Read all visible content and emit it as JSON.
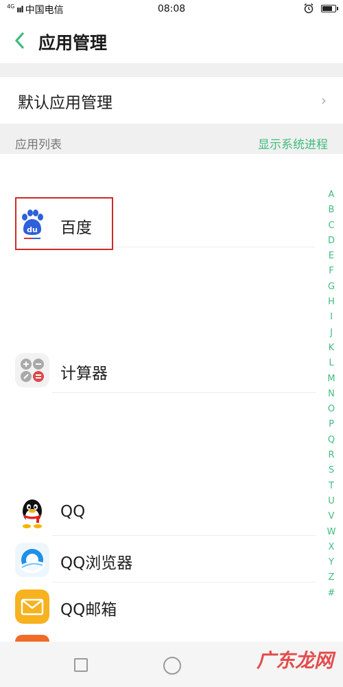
{
  "status_bar": {
    "network": "4G",
    "signal": "ııl",
    "carrier": "中国电信",
    "time": "08:08"
  },
  "header": {
    "title": "应用管理"
  },
  "default_apps": {
    "label": "默认应用管理",
    "chevron": "›"
  },
  "section": {
    "title": "应用列表",
    "show_system_link": "显示系统进程"
  },
  "apps": [
    {
      "name": "百度",
      "icon": "baidu-icon"
    },
    {
      "name": "计算器",
      "icon": "calculator-icon"
    },
    {
      "name": "QQ",
      "icon": "qq-penguin-icon"
    },
    {
      "name": "QQ浏览器",
      "icon": "qq-browser-icon"
    },
    {
      "name": "QQ邮箱",
      "icon": "qq-mail-icon"
    }
  ],
  "alpha_index": [
    "A",
    "B",
    "C",
    "D",
    "E",
    "F",
    "G",
    "H",
    "I",
    "J",
    "K",
    "L",
    "M",
    "N",
    "O",
    "P",
    "Q",
    "R",
    "S",
    "T",
    "U",
    "V",
    "W",
    "X",
    "Y",
    "Z",
    "#"
  ],
  "watermark": "广东龙网",
  "colors": {
    "accent": "#3fbc7e",
    "highlight": "#cc2a2a"
  }
}
